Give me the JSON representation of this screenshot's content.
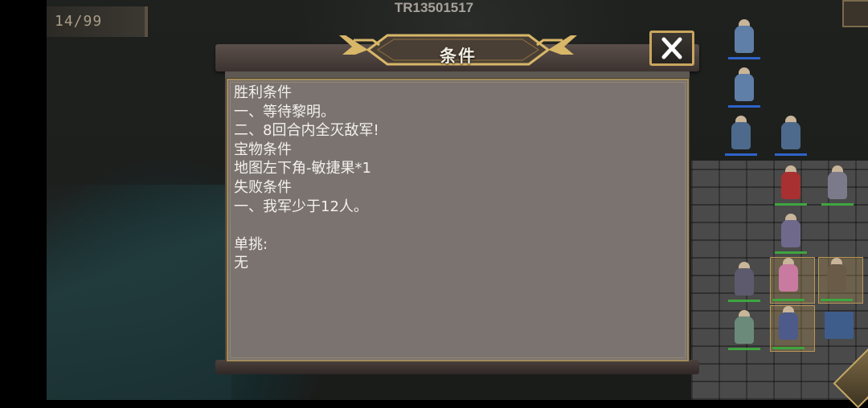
{
  "hud": {
    "turn_counter": "14/99",
    "map_code": "TR13501517"
  },
  "dialog": {
    "title": "条件",
    "close_icon": "close-x-icon",
    "lines": [
      "胜利条件",
      "一、等待黎明。",
      "二、8回合内全灭敌军!",
      "宝物条件",
      "地图左下角-敏捷果*1",
      "失败条件",
      "一、我军少于12人。",
      "",
      "单挑:",
      "无"
    ]
  },
  "colors": {
    "accent_gold": "#c9a65e",
    "panel": "#7a7370",
    "text": "#f3f0ec",
    "ally_hp": "#2f63c9",
    "friendly_hp": "#3fa53f"
  }
}
